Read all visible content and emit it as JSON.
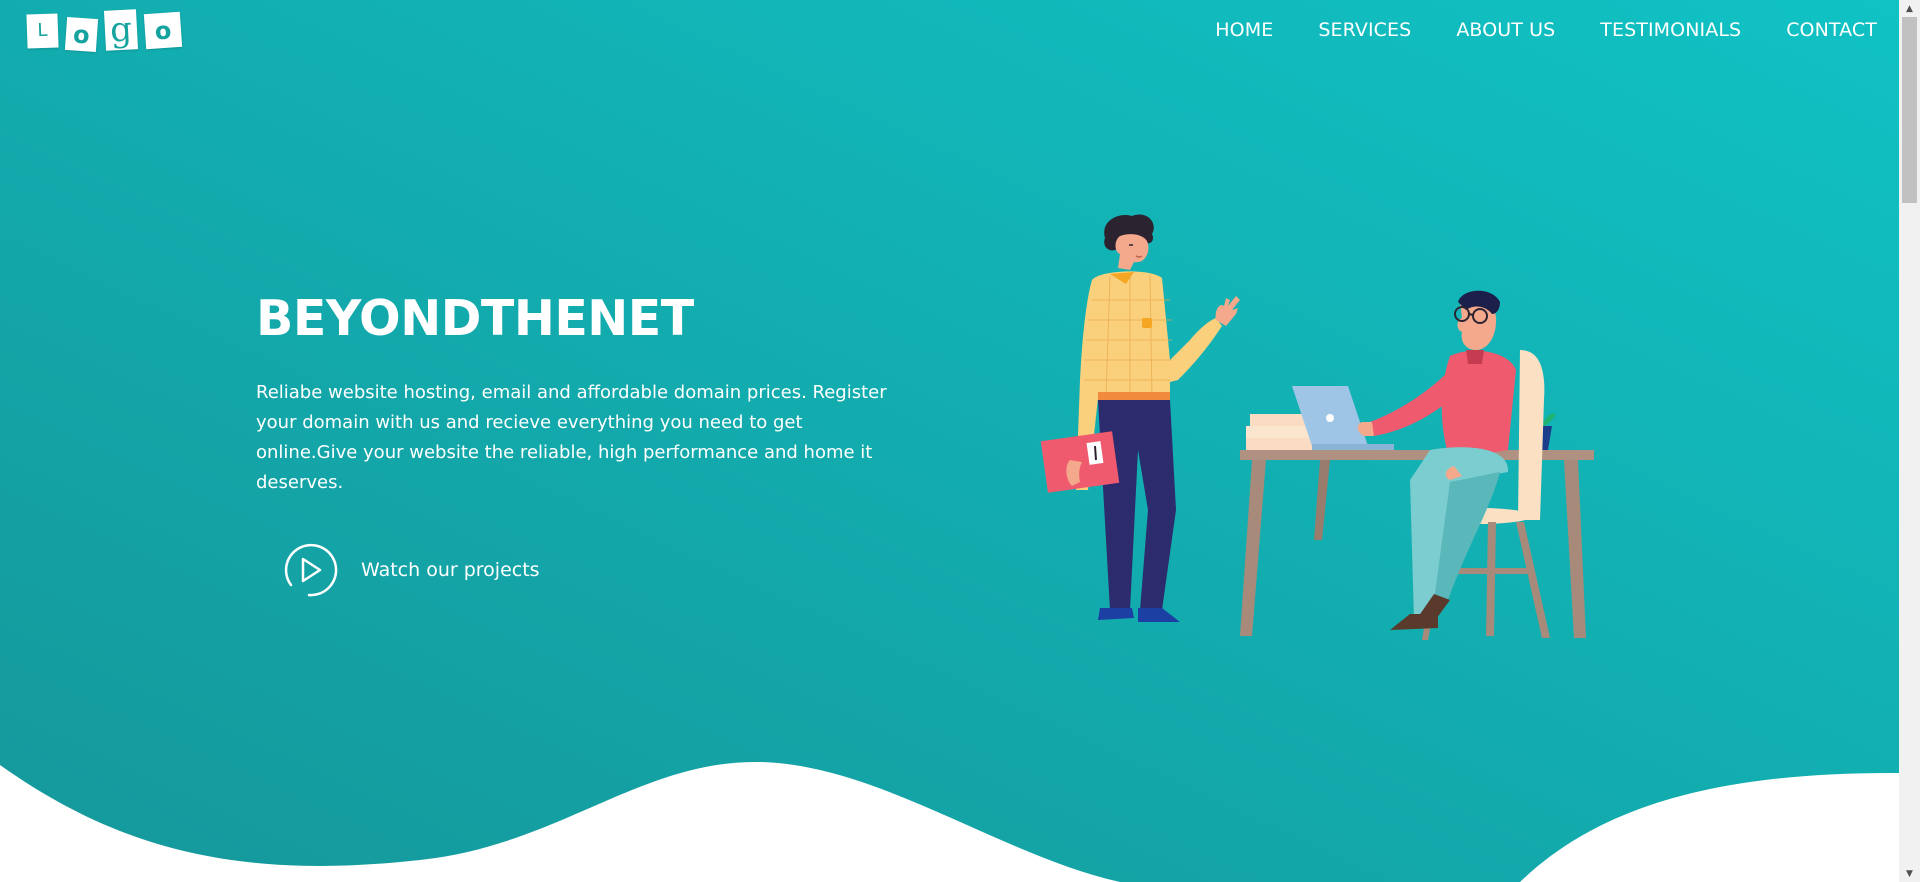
{
  "logo": {
    "letters": [
      "L",
      "o",
      "g",
      "o"
    ]
  },
  "nav": {
    "items": [
      {
        "label": "HOME"
      },
      {
        "label": "SERVICES"
      },
      {
        "label": "ABOUT US"
      },
      {
        "label": "TESTIMONIALS"
      },
      {
        "label": "CONTACT"
      }
    ]
  },
  "hero": {
    "title": "BEYONDTHENET",
    "description": "Reliabe website hosting, email and affordable domain prices. Register your domain with us and recieve everything you need to get online.Give your website the reliable, high performance and home it deserves.",
    "cta_label": "Watch our projects",
    "cta_icon": "play-circle-icon"
  },
  "colors": {
    "gradient_start": "#15979a",
    "gradient_end": "#10c2c4",
    "text": "#ffffff",
    "wave": "#ffffff"
  },
  "scrollbar": {
    "up_icon": "▲",
    "down_icon": "▼"
  }
}
